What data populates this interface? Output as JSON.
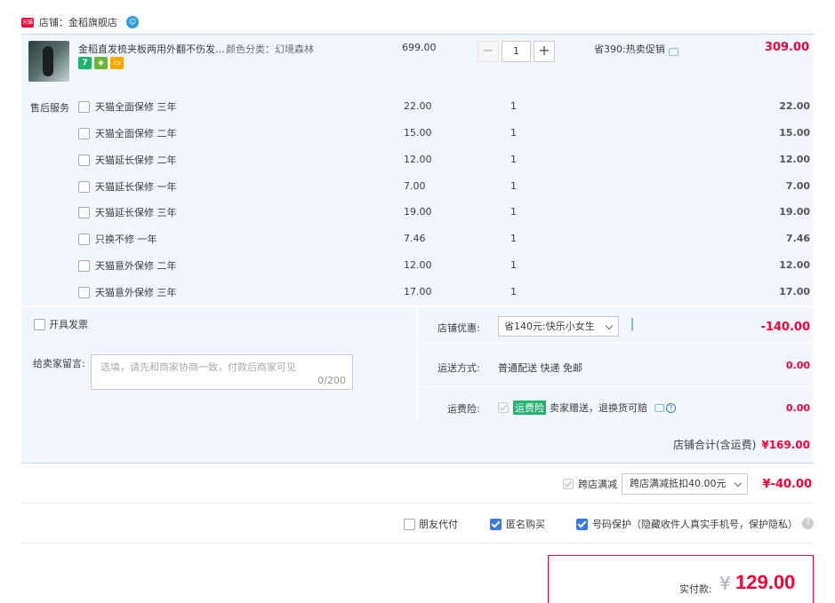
{
  "shop": {
    "label": "店铺：金稻旗舰店",
    "tag_icon": "tmall-icon",
    "ww_icon": "wangwang-icon"
  },
  "item": {
    "title": "金稻直发梳夹板两用外翻不伤发...",
    "sku": "颜色分类：幻境森林",
    "badges": [
      "7",
      "",
      ""
    ],
    "unit_price": "699.00",
    "quantity": "1",
    "promo": "省390:热卖促销",
    "total": "309.00"
  },
  "services": {
    "label": "售后服务",
    "rows": [
      {
        "name": "天猫全面保修 三年",
        "price": "22.00",
        "qty": "1",
        "total": "22.00"
      },
      {
        "name": "天猫全面保修 二年",
        "price": "15.00",
        "qty": "1",
        "total": "15.00"
      },
      {
        "name": "天猫延长保修 二年",
        "price": "12.00",
        "qty": "1",
        "total": "12.00"
      },
      {
        "name": "天猫延长保修 一年",
        "price": "7.00",
        "qty": "1",
        "total": "7.00"
      },
      {
        "name": "天猫延长保修 三年",
        "price": "19.00",
        "qty": "1",
        "total": "19.00"
      },
      {
        "name": "只换不修 一年",
        "price": "7.46",
        "qty": "1",
        "total": "7.46"
      },
      {
        "name": "天猫意外保修 二年",
        "price": "12.00",
        "qty": "1",
        "total": "12.00"
      },
      {
        "name": "天猫意外保修 三年",
        "price": "17.00",
        "qty": "1",
        "total": "17.00"
      }
    ]
  },
  "invoice_label": "开具发票",
  "message": {
    "label": "给卖家留言:",
    "placeholder": "选填，请先和商家协商一致，付款后商家可见",
    "count": "0/200"
  },
  "coupon": {
    "label": "店铺优惠:",
    "value": "省140元:快乐小女生",
    "amount": "-140.00"
  },
  "shipping": {
    "label": "运送方式:",
    "value": "普通配送 快递 免邮",
    "amount": "0.00"
  },
  "insurance": {
    "label": "运费险:",
    "tag": "运费险",
    "text": "卖家赠送，退换货可赔",
    "amount": "0.00"
  },
  "shop_total": {
    "label": "店铺合计(含运费)",
    "value": "¥169.00"
  },
  "cross_store": {
    "label": "跨店满减",
    "value": "跨店满减抵扣40.00元",
    "amount": "¥-40.00"
  },
  "options": {
    "friend_pay": "朋友代付",
    "anonymous": "匿名购买",
    "privacy": "号码保护（隐藏收件人真实手机号，保护隐私）",
    "help": "?"
  },
  "payment": {
    "label": "实付款:",
    "currency": "¥",
    "value": "129.00"
  },
  "colors": {
    "accent": "#ff0036",
    "panel": "#f2f7ff",
    "check": "#3a7ae0"
  }
}
